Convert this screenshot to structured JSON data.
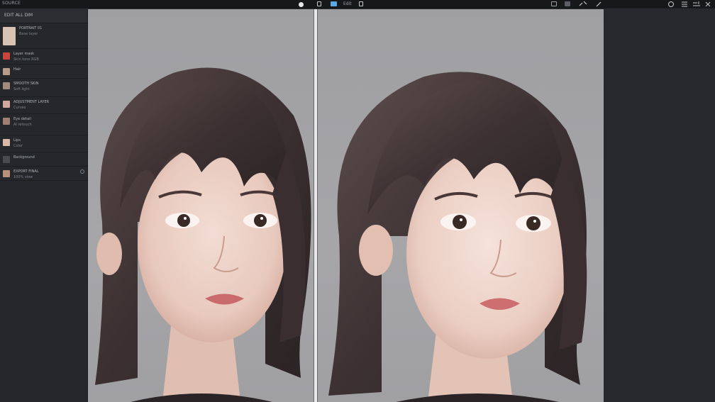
{
  "app": {
    "title": "SOURCE"
  },
  "topbar": {
    "tab_label": "Edit",
    "icons": [
      "select-icon",
      "layers-icon",
      "image-icon",
      "save-icon",
      "grid-icon",
      "brush-icon",
      "pen-icon",
      "history-icon",
      "menu-icon",
      "settings-icon"
    ]
  },
  "left_panel": {
    "header": "EDIT ALL DIM",
    "layers": [
      {
        "l1": "PORTRAIT 01",
        "l2": "Base layer",
        "thumb": "#d8c2b4"
      },
      {
        "l1": "Layer mask",
        "l2": "Skin tone RGB",
        "thumb": "#c9463f"
      },
      {
        "l1": "Hair",
        "l2": "",
        "thumb": "#b79c8a"
      },
      {
        "l1": "SMOOTH SKIN",
        "l2": "Soft light",
        "thumb": "#a08b80"
      },
      {
        "l1": "ADJUSTMENT LAYER",
        "l2": "Curves",
        "thumb": "#cfa9a0"
      },
      {
        "l1": "Eye detail",
        "l2": "AI retouch",
        "thumb": "#9f7e73"
      },
      {
        "l1": "Lips",
        "l2": "Color",
        "thumb": "#d8b8a6"
      },
      {
        "l1": "Background",
        "l2": "",
        "thumb": "#4a4b4f"
      },
      {
        "l1": "EXPORT FINAL",
        "l2": "100% view",
        "thumb": "#b88f7c"
      }
    ]
  },
  "colors": {
    "app_bg": "#1f2124",
    "panel_bg": "#25272b",
    "canvas_bg": "#a3a3a6",
    "accent_blue": "#5aa9e6"
  }
}
